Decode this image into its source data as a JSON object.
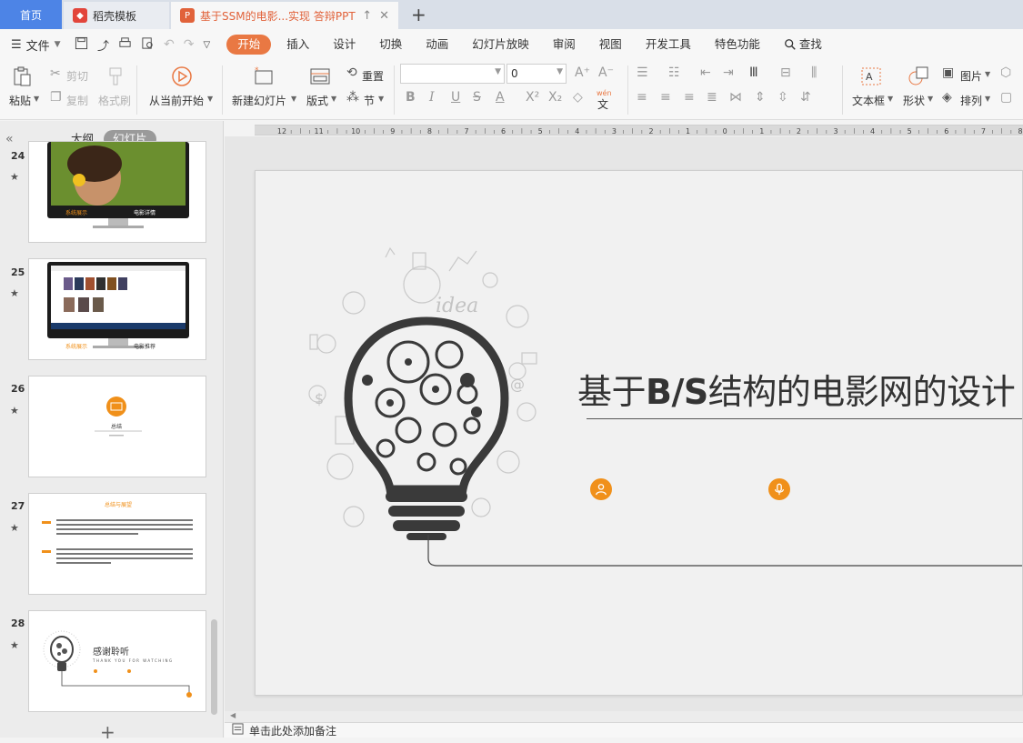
{
  "tabs": {
    "home": "首页",
    "template": "稻壳模板",
    "document": "基于SSM的电影...实现 答辩PPT"
  },
  "menu": {
    "file": "文件",
    "tabs": [
      "开始",
      "插入",
      "设计",
      "切换",
      "动画",
      "幻灯片放映",
      "审阅",
      "视图",
      "开发工具",
      "特色功能"
    ],
    "search": "查找"
  },
  "ribbon": {
    "paste": "粘贴",
    "cut": "剪切",
    "copy": "复制",
    "format_painter": "格式刷",
    "from_current": "从当前开始",
    "new_slide": "新建幻灯片",
    "layout": "版式",
    "reset": "重置",
    "section": "节",
    "font_size": "0",
    "text_box": "文本框",
    "shape": "形状",
    "picture": "图片",
    "arrange": "排列",
    "pinyin": "wén"
  },
  "left_panel": {
    "tab_outline": "大纲",
    "tab_slides": "幻灯片",
    "slides": [
      {
        "num": "24",
        "caption_left": "系统展示",
        "caption_right": "电影详情"
      },
      {
        "num": "25",
        "caption_left": "系统展示",
        "caption_right": "电影推荐"
      },
      {
        "num": "26",
        "caption_center": "总结"
      },
      {
        "num": "27",
        "title": "总结与展望"
      },
      {
        "num": "28",
        "title": "感谢聆听",
        "subtitle": "THANK YOU FOR WATCHING"
      }
    ]
  },
  "ruler": [
    "12",
    "11",
    "10",
    "9",
    "8",
    "7",
    "6",
    "5",
    "4",
    "3",
    "2",
    "1",
    "0",
    "1",
    "2",
    "3",
    "4",
    "5",
    "6",
    "7",
    "8"
  ],
  "slide": {
    "title_prefix": "基于",
    "title_bold": "B/S",
    "title_suffix": "结构的电影网的设计",
    "idea_word": "idea"
  },
  "notes_placeholder": "单击此处添加备注",
  "colors": {
    "accent_orange": "#e97843",
    "home_blue": "#4d84e6",
    "dot_orange": "#f0901a"
  }
}
